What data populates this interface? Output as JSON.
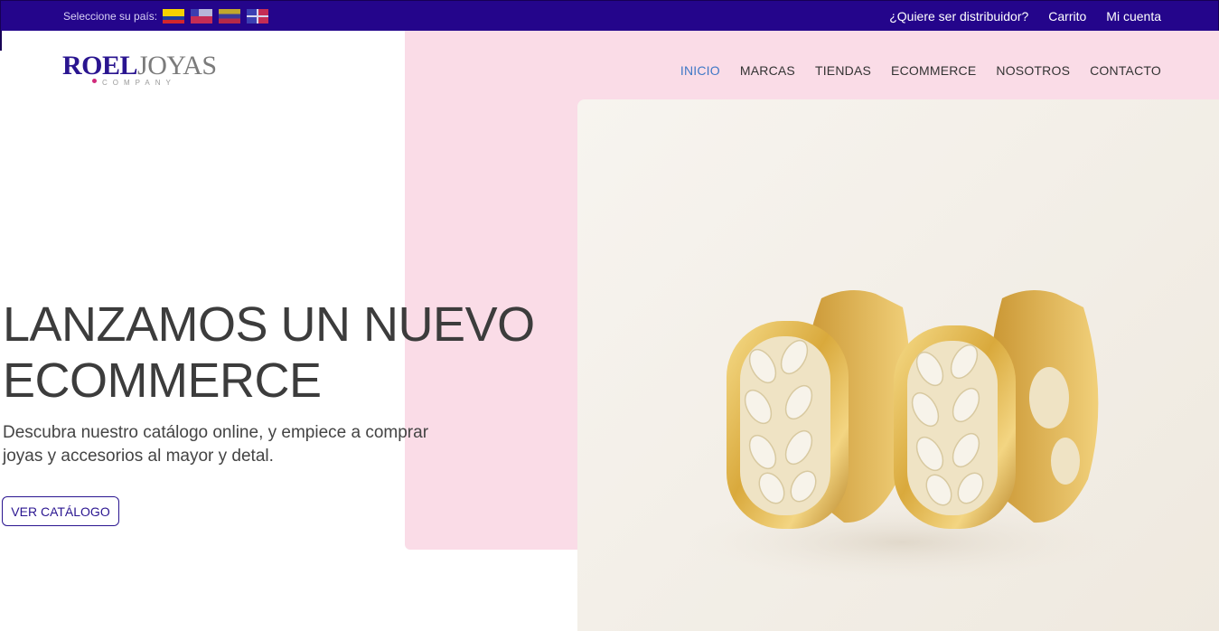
{
  "topbar": {
    "country_label": "Seleccione su país:",
    "flags": [
      {
        "icon": "flag-colombia-icon"
      },
      {
        "icon": "flag-chile-icon"
      },
      {
        "icon": "flag-venezuela-icon"
      },
      {
        "icon": "flag-dominican-republic-icon"
      }
    ],
    "links": [
      "¿Quiere ser distribuidor?",
      "Carrito",
      "Mi cuenta"
    ],
    "background_color": "#24058b"
  },
  "logo": {
    "part1": "ROEL",
    "part2": "JOYAS",
    "subtitle": "COMPANY"
  },
  "nav": {
    "items": [
      "INICIO",
      "MARCAS",
      "TIENDAS",
      "ECOMMERCE",
      "NOSOTROS",
      "CONTACTO"
    ],
    "active": "INICIO",
    "active_color": "#3f78c6"
  },
  "hero": {
    "title_line1": "LANZAMOS UN NUEVO",
    "title_line2": "ECOMMERCE",
    "description": "Descubra nuestro catálogo online, y empiece a comprar joyas y accesorios al mayor y detal.",
    "cta_label": "VER CATÁLOGO",
    "accent_pink": "#fadce7",
    "image_icon": "gold-hoop-earrings-image"
  }
}
